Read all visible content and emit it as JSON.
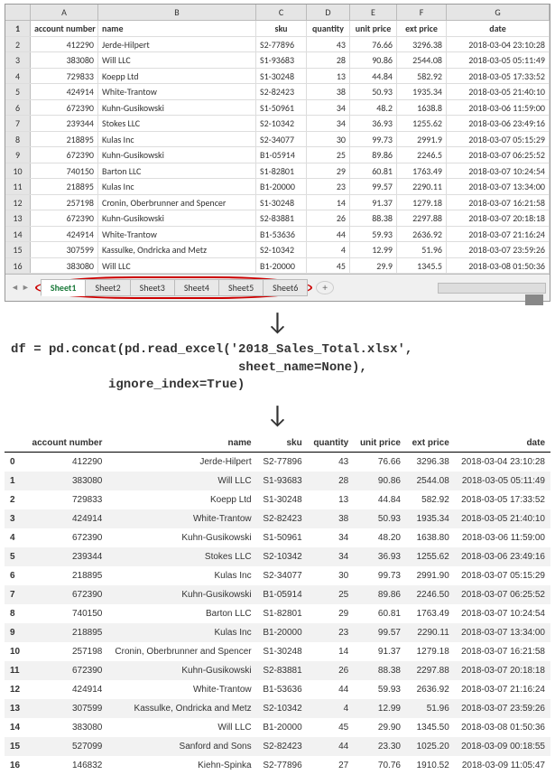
{
  "excel": {
    "cols": [
      "A",
      "B",
      "C",
      "D",
      "E",
      "F",
      "G"
    ],
    "headers": [
      "account number",
      "name",
      "sku",
      "quantity",
      "unit price",
      "ext price",
      "date"
    ],
    "rows": [
      {
        "n": 1,
        "cells": [
          "account number",
          "name",
          "sku",
          "quantity",
          "unit price",
          "ext price",
          "date"
        ]
      },
      {
        "n": 2,
        "cells": [
          "412290",
          "Jerde-Hilpert",
          "S2-77896",
          "43",
          "76.66",
          "3296.38",
          "2018-03-04 23:10:28"
        ]
      },
      {
        "n": 3,
        "cells": [
          "383080",
          "Will LLC",
          "S1-93683",
          "28",
          "90.86",
          "2544.08",
          "2018-03-05 05:11:49"
        ]
      },
      {
        "n": 4,
        "cells": [
          "729833",
          "Koepp Ltd",
          "S1-30248",
          "13",
          "44.84",
          "582.92",
          "2018-03-05 17:33:52"
        ]
      },
      {
        "n": 5,
        "cells": [
          "424914",
          "White-Trantow",
          "S2-82423",
          "38",
          "50.93",
          "1935.34",
          "2018-03-05 21:40:10"
        ]
      },
      {
        "n": 6,
        "cells": [
          "672390",
          "Kuhn-Gusikowski",
          "S1-50961",
          "34",
          "48.2",
          "1638.8",
          "2018-03-06 11:59:00"
        ]
      },
      {
        "n": 7,
        "cells": [
          "239344",
          "Stokes LLC",
          "S2-10342",
          "34",
          "36.93",
          "1255.62",
          "2018-03-06 23:49:16"
        ]
      },
      {
        "n": 8,
        "cells": [
          "218895",
          "Kulas Inc",
          "S2-34077",
          "30",
          "99.73",
          "2991.9",
          "2018-03-07 05:15:29"
        ]
      },
      {
        "n": 9,
        "cells": [
          "672390",
          "Kuhn-Gusikowski",
          "B1-05914",
          "25",
          "89.86",
          "2246.5",
          "2018-03-07 06:25:52"
        ]
      },
      {
        "n": 10,
        "cells": [
          "740150",
          "Barton LLC",
          "S1-82801",
          "29",
          "60.81",
          "1763.49",
          "2018-03-07 10:24:54"
        ]
      },
      {
        "n": 11,
        "cells": [
          "218895",
          "Kulas Inc",
          "B1-20000",
          "23",
          "99.57",
          "2290.11",
          "2018-03-07 13:34:00"
        ]
      },
      {
        "n": 12,
        "cells": [
          "257198",
          "Cronin, Oberbrunner and Spencer",
          "S1-30248",
          "14",
          "91.37",
          "1279.18",
          "2018-03-07 16:21:58"
        ]
      },
      {
        "n": 13,
        "cells": [
          "672390",
          "Kuhn-Gusikowski",
          "S2-83881",
          "26",
          "88.38",
          "2297.88",
          "2018-03-07 20:18:18"
        ]
      },
      {
        "n": 14,
        "cells": [
          "424914",
          "White-Trantow",
          "B1-53636",
          "44",
          "59.93",
          "2636.92",
          "2018-03-07 21:16:24"
        ]
      },
      {
        "n": 15,
        "cells": [
          "307599",
          "Kassulke, Ondricka and Metz",
          "S2-10342",
          "4",
          "12.99",
          "51.96",
          "2018-03-07 23:59:26"
        ]
      },
      {
        "n": 16,
        "cells": [
          "383080",
          "Will LLC",
          "B1-20000",
          "45",
          "29.9",
          "1345.5",
          "2018-03-08 01:50:36"
        ]
      }
    ],
    "sheets": [
      "Sheet1",
      "Sheet2",
      "Sheet3",
      "Sheet4",
      "Sheet5",
      "Sheet6"
    ]
  },
  "code": {
    "line1": "df = pd.concat(pd.read_excel('2018_Sales_Total.xlsx',",
    "line2": "sheet_name=None),",
    "line3": "ignore_index=True)"
  },
  "df": {
    "headers": [
      "account number",
      "name",
      "sku",
      "quantity",
      "unit price",
      "ext price",
      "date"
    ],
    "rows": [
      {
        "i": "0",
        "v": [
          "412290",
          "Jerde-Hilpert",
          "S2-77896",
          "43",
          "76.66",
          "3296.38",
          "2018-03-04 23:10:28"
        ]
      },
      {
        "i": "1",
        "v": [
          "383080",
          "Will LLC",
          "S1-93683",
          "28",
          "90.86",
          "2544.08",
          "2018-03-05 05:11:49"
        ]
      },
      {
        "i": "2",
        "v": [
          "729833",
          "Koepp Ltd",
          "S1-30248",
          "13",
          "44.84",
          "582.92",
          "2018-03-05 17:33:52"
        ]
      },
      {
        "i": "3",
        "v": [
          "424914",
          "White-Trantow",
          "S2-82423",
          "38",
          "50.93",
          "1935.34",
          "2018-03-05 21:40:10"
        ]
      },
      {
        "i": "4",
        "v": [
          "672390",
          "Kuhn-Gusikowski",
          "S1-50961",
          "34",
          "48.20",
          "1638.80",
          "2018-03-06 11:59:00"
        ]
      },
      {
        "i": "5",
        "v": [
          "239344",
          "Stokes LLC",
          "S2-10342",
          "34",
          "36.93",
          "1255.62",
          "2018-03-06 23:49:16"
        ]
      },
      {
        "i": "6",
        "v": [
          "218895",
          "Kulas Inc",
          "S2-34077",
          "30",
          "99.73",
          "2991.90",
          "2018-03-07 05:15:29"
        ]
      },
      {
        "i": "7",
        "v": [
          "672390",
          "Kuhn-Gusikowski",
          "B1-05914",
          "25",
          "89.86",
          "2246.50",
          "2018-03-07 06:25:52"
        ]
      },
      {
        "i": "8",
        "v": [
          "740150",
          "Barton LLC",
          "S1-82801",
          "29",
          "60.81",
          "1763.49",
          "2018-03-07 10:24:54"
        ]
      },
      {
        "i": "9",
        "v": [
          "218895",
          "Kulas Inc",
          "B1-20000",
          "23",
          "99.57",
          "2290.11",
          "2018-03-07 13:34:00"
        ]
      },
      {
        "i": "10",
        "v": [
          "257198",
          "Cronin, Oberbrunner and Spencer",
          "S1-30248",
          "14",
          "91.37",
          "1279.18",
          "2018-03-07 16:21:58"
        ]
      },
      {
        "i": "11",
        "v": [
          "672390",
          "Kuhn-Gusikowski",
          "S2-83881",
          "26",
          "88.38",
          "2297.88",
          "2018-03-07 20:18:18"
        ]
      },
      {
        "i": "12",
        "v": [
          "424914",
          "White-Trantow",
          "B1-53636",
          "44",
          "59.93",
          "2636.92",
          "2018-03-07 21:16:24"
        ]
      },
      {
        "i": "13",
        "v": [
          "307599",
          "Kassulke, Ondricka and Metz",
          "S2-10342",
          "4",
          "12.99",
          "51.96",
          "2018-03-07 23:59:26"
        ]
      },
      {
        "i": "14",
        "v": [
          "383080",
          "Will LLC",
          "B1-20000",
          "45",
          "29.90",
          "1345.50",
          "2018-03-08 01:50:36"
        ]
      },
      {
        "i": "15",
        "v": [
          "527099",
          "Sanford and Sons",
          "S2-82423",
          "44",
          "23.30",
          "1025.20",
          "2018-03-09 00:18:55"
        ]
      },
      {
        "i": "16",
        "v": [
          "146832",
          "Kiehn-Spinka",
          "S2-77896",
          "27",
          "70.76",
          "1910.52",
          "2018-03-09 11:05:47"
        ]
      }
    ]
  }
}
